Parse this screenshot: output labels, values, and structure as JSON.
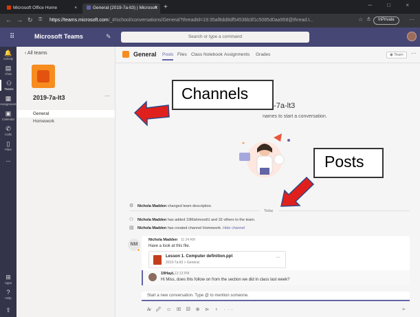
{
  "browser": {
    "tabs": [
      {
        "label": "Microsoft Office Home",
        "close": "×"
      },
      {
        "label": "General (2019-7a-lt3) | Microsoft",
        "close": "×"
      }
    ],
    "new_tab": "+",
    "url_host": "https://teams.microsoft.com",
    "url_path": "/_#/school/conversations/General?threadId=19:35af8dd8df54536b3f1c5085d0aa958@thread.t...",
    "inprivate_label": "InPrivate",
    "back_icon": "←",
    "forward_icon": "→",
    "refresh_icon": "↻",
    "lock_icon": "🔒",
    "more_icon": "···",
    "window_controls": "─ □ ×"
  },
  "teams": {
    "title": "Microsoft Teams",
    "search_placeholder": "Search or type a command"
  },
  "rail": [
    {
      "label": "Activity",
      "icon": "🔔"
    },
    {
      "label": "Chat",
      "icon": "▤"
    },
    {
      "label": "Teams",
      "icon": "⚇"
    },
    {
      "label": "Assignments",
      "icon": "▦"
    },
    {
      "label": "Calendar",
      "icon": "▣"
    },
    {
      "label": "Calls",
      "icon": "✆"
    },
    {
      "label": "Files",
      "icon": "▯"
    },
    {
      "label": "...",
      "icon": ""
    },
    {
      "label": "Apps",
      "icon": "⊞"
    },
    {
      "label": "Help",
      "icon": "?"
    }
  ],
  "sidebar": {
    "back_label": "All teams",
    "team_name": "2019-7a-lt3",
    "more": "···",
    "channels": [
      "General",
      "Homework"
    ]
  },
  "channel": {
    "name": "General",
    "tabs": [
      "Posts",
      "Files",
      "Class Notebook",
      "Assignments",
      "Grades"
    ],
    "team_button": "Team",
    "more": "···"
  },
  "welcome": {
    "title_visible": "9-7a-lt3",
    "subtitle_visible": "names to start a conversation."
  },
  "activity": [
    {
      "author": "Nichola Madden",
      "text": " changed team description."
    },
    {
      "author": "Nichola Madden",
      "text": " has added 19MahmoodU and 32 others to the team."
    },
    {
      "author": "Nichola Madden",
      "text": " has created channel Homework. ",
      "link": "Hide channel"
    }
  ],
  "today_label": "Today",
  "post": {
    "initials": "NM",
    "author": "Nichola Madden",
    "time": "11:24 AM",
    "text": "Have a look at this file.",
    "file_name": "Lesson 1. Computer definition.ppt",
    "file_path": "2019-7a-lt3 > General",
    "file_more": "···"
  },
  "reply": {
    "author": "19HayL",
    "time": "12:13 PM",
    "text": "Hi Miss, does this follow on from the section we did in class last week?"
  },
  "compose": {
    "placeholder": "Start a new conversation. Type @ to mention someone.",
    "toolbar": "A̷ 🖉 ☺ ▣ ▨ ⊕ ⊳ ♀ ···",
    "send_icon": "➢"
  },
  "annotations": {
    "channels_label": "Channels",
    "posts_label": "Posts",
    "arrow_color": "#e0201d"
  }
}
